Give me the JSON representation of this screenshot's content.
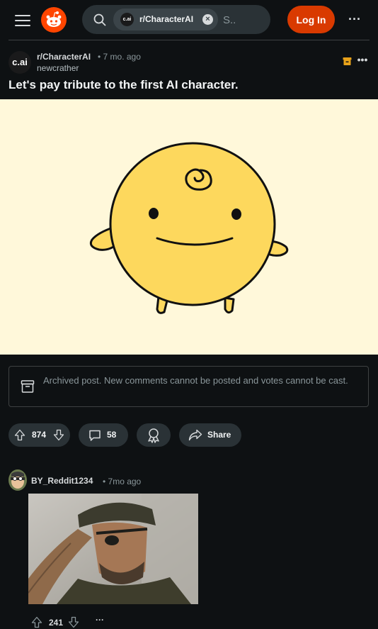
{
  "header": {
    "search_chip": {
      "avatar_text": "c.ai",
      "label": "r/CharacterAI",
      "close_icon": "×"
    },
    "search_placeholder": "S..",
    "login_label": "Log In",
    "more_icon": "···"
  },
  "post": {
    "subreddit_avatar_text": "c.ai",
    "subreddit": "r/CharacterAI",
    "time": "• 7 mo. ago",
    "author": "newcrather",
    "more_icon": "•••",
    "title": "Let's pay tribute to the first AI character.",
    "archived_notice": "Archived post. New comments cannot be posted and votes cannot be cast.",
    "votes": "874",
    "comments": "58",
    "share_label": "Share",
    "image_bg": "#fff8da",
    "mascot_color": "#fdd85d"
  },
  "comment": {
    "author": "BY_Reddit1234",
    "time": "• 7mo ago",
    "votes": "241",
    "more_icon": "···"
  },
  "colors": {
    "background": "#0e1113",
    "accent": "#d93a00",
    "pill": "#2a3236",
    "muted_text": "#8a969a"
  }
}
